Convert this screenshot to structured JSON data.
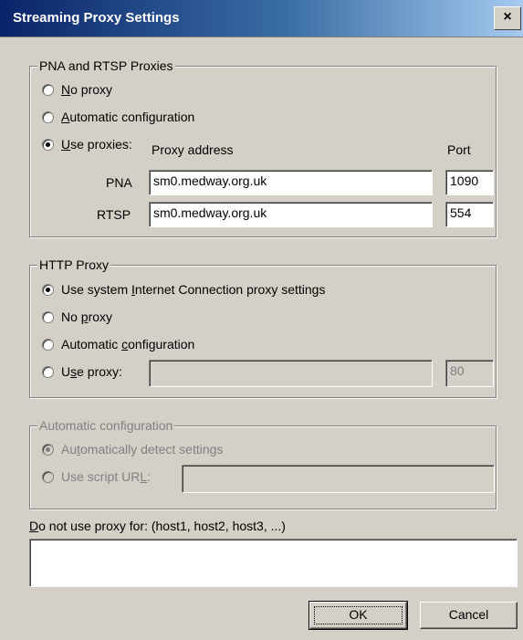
{
  "window": {
    "title": "Streaming Proxy Settings",
    "close_glyph": "×"
  },
  "pna_rtsp": {
    "legend": "PNA and RTSP Proxies",
    "no_proxy": "No proxy",
    "auto_config": "Automatic configuration",
    "use_proxies": "Use proxies:",
    "selected": "use_proxies",
    "proxy_address_header": "Proxy address",
    "port_header": "Port",
    "pna_label": "PNA",
    "pna_address": "sm0.medway.org.uk",
    "pna_port": "1090",
    "rtsp_label": "RTSP",
    "rtsp_address": "sm0.medway.org.uk",
    "rtsp_port": "554"
  },
  "http": {
    "legend": "HTTP Proxy",
    "use_system": "Use system Internet Connection proxy settings",
    "no_proxy": "No proxy",
    "auto_config": "Automatic configuration",
    "use_proxy": "Use proxy:",
    "selected": "use_system",
    "proxy_address": "",
    "port": "80"
  },
  "auto_config": {
    "legend": "Automatic configuration",
    "detect": "Automatically detect settings",
    "script_url": "Use script URL:",
    "script_value": ""
  },
  "bypass": {
    "label": "Do not use proxy for: (host1, host2, host3, ...)",
    "value": ""
  },
  "buttons": {
    "ok": "OK",
    "cancel": "Cancel"
  }
}
